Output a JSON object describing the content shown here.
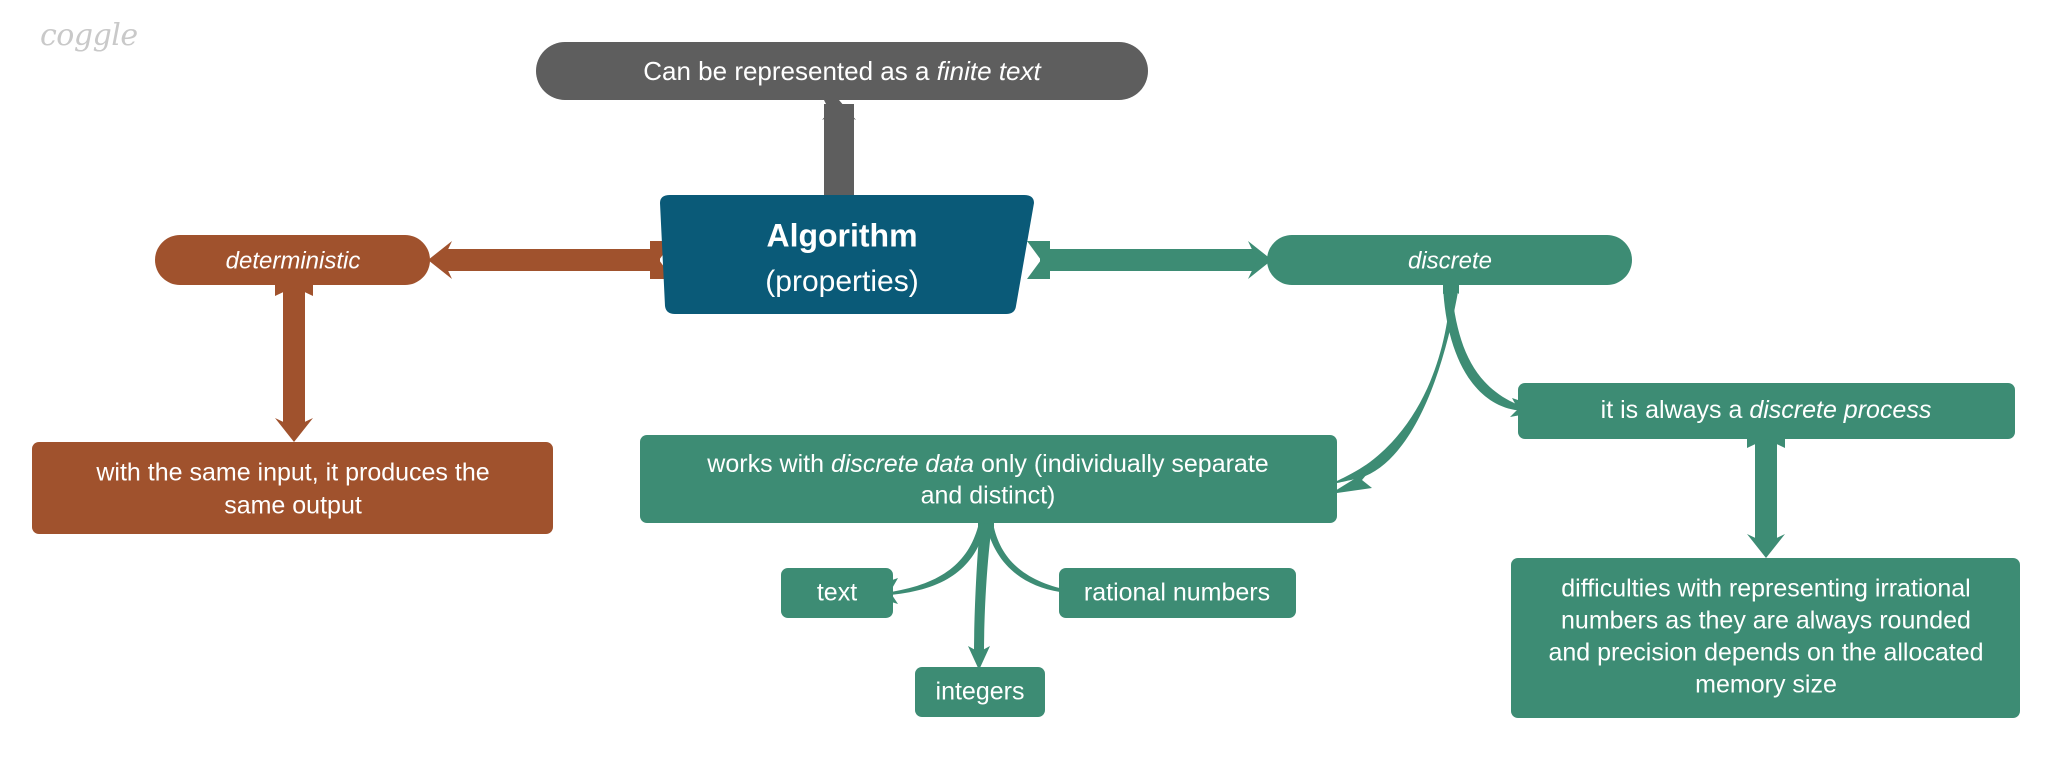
{
  "brand": {
    "logo_text": "coggle"
  },
  "colors": {
    "background": "#ffffff",
    "root": "#0a5a78",
    "gray": "#5e5e5e",
    "brown": "#a0522d",
    "green": "#3d8c74",
    "text": "#ffffff",
    "logo": "#c9c9c9"
  },
  "chart_data": {
    "type": "diagram",
    "title": "Algorithm (properties)",
    "layout": "mind-map",
    "nodes": [
      {
        "id": "root",
        "label_line1": "Algorithm",
        "label_line2": "(properties)",
        "shape": "trapezoid",
        "color": "#0a5a78"
      },
      {
        "id": "finite_text",
        "label": "Can be represented as a finite text",
        "shape": "pill",
        "color": "#5e5e5e",
        "emphasis": "finite text"
      },
      {
        "id": "deterministic",
        "label": "deterministic",
        "shape": "pill",
        "color": "#a0522d",
        "emphasis": "deterministic"
      },
      {
        "id": "discrete",
        "label": "discrete",
        "shape": "pill",
        "color": "#3d8c74",
        "emphasis": "discrete"
      },
      {
        "id": "same_output",
        "label": "with the same input, it produces the same output",
        "shape": "rounded-rect",
        "color": "#a0522d"
      },
      {
        "id": "discrete_data",
        "label": "works with discrete data only (individually separate and distinct)",
        "shape": "rounded-rect",
        "color": "#3d8c74",
        "emphasis": "discrete data"
      },
      {
        "id": "discrete_process",
        "label": "it is always a discrete process",
        "shape": "rounded-rect",
        "color": "#3d8c74",
        "emphasis": "discrete process"
      },
      {
        "id": "irrational",
        "label": "difficulties with representing irrational numbers as they are always rounded and precision depends on the allocated memory size",
        "shape": "rounded-rect",
        "color": "#3d8c74"
      },
      {
        "id": "text",
        "label": "text",
        "shape": "rounded-rect",
        "color": "#3d8c74"
      },
      {
        "id": "integers",
        "label": "integers",
        "shape": "rounded-rect",
        "color": "#3d8c74"
      },
      {
        "id": "rational_numbers",
        "label": "rational numbers",
        "shape": "rounded-rect",
        "color": "#3d8c74"
      }
    ],
    "edges": [
      {
        "from": "root",
        "to": "finite_text",
        "color": "#5e5e5e",
        "style": "straight-arrow"
      },
      {
        "from": "root",
        "to": "deterministic",
        "color": "#a0522d",
        "style": "straight-arrow"
      },
      {
        "from": "root",
        "to": "discrete",
        "color": "#3d8c74",
        "style": "straight-arrow"
      },
      {
        "from": "deterministic",
        "to": "same_output",
        "color": "#a0522d",
        "style": "straight-arrow"
      },
      {
        "from": "discrete",
        "to": "discrete_data",
        "color": "#3d8c74",
        "style": "curve"
      },
      {
        "from": "discrete",
        "to": "discrete_process",
        "color": "#3d8c74",
        "style": "curve"
      },
      {
        "from": "discrete_process",
        "to": "irrational",
        "color": "#3d8c74",
        "style": "straight-arrow"
      },
      {
        "from": "discrete_data",
        "to": "text",
        "color": "#3d8c74",
        "style": "curve"
      },
      {
        "from": "discrete_data",
        "to": "integers",
        "color": "#3d8c74",
        "style": "curve"
      },
      {
        "from": "discrete_data",
        "to": "rational_numbers",
        "color": "#3d8c74",
        "style": "curve"
      }
    ]
  },
  "nodes": {
    "root": {
      "line1": "Algorithm",
      "line2": "(properties)"
    },
    "finite_text": {
      "part1": "Can be represented as a ",
      "part2": "finite text"
    },
    "deterministic": {
      "label": "deterministic"
    },
    "discrete": {
      "label": "discrete"
    },
    "same_output": {
      "line1": "with the same input, it produces the",
      "line2": "same output"
    },
    "discrete_data": {
      "l1a": "works with ",
      "l1b": "discrete data",
      "l1c": " only (individually separate",
      "line2": "and distinct)"
    },
    "discrete_process": {
      "part1": "it is always a ",
      "part2": "discrete process"
    },
    "irrational": {
      "line1": "difficulties with representing irrational",
      "line2": "numbers as they are always rounded",
      "line3": "and precision depends on the allocated",
      "line4": "memory size"
    },
    "text": {
      "label": "text"
    },
    "integers": {
      "label": "integers"
    },
    "rational_numbers": {
      "label": "rational numbers"
    }
  }
}
